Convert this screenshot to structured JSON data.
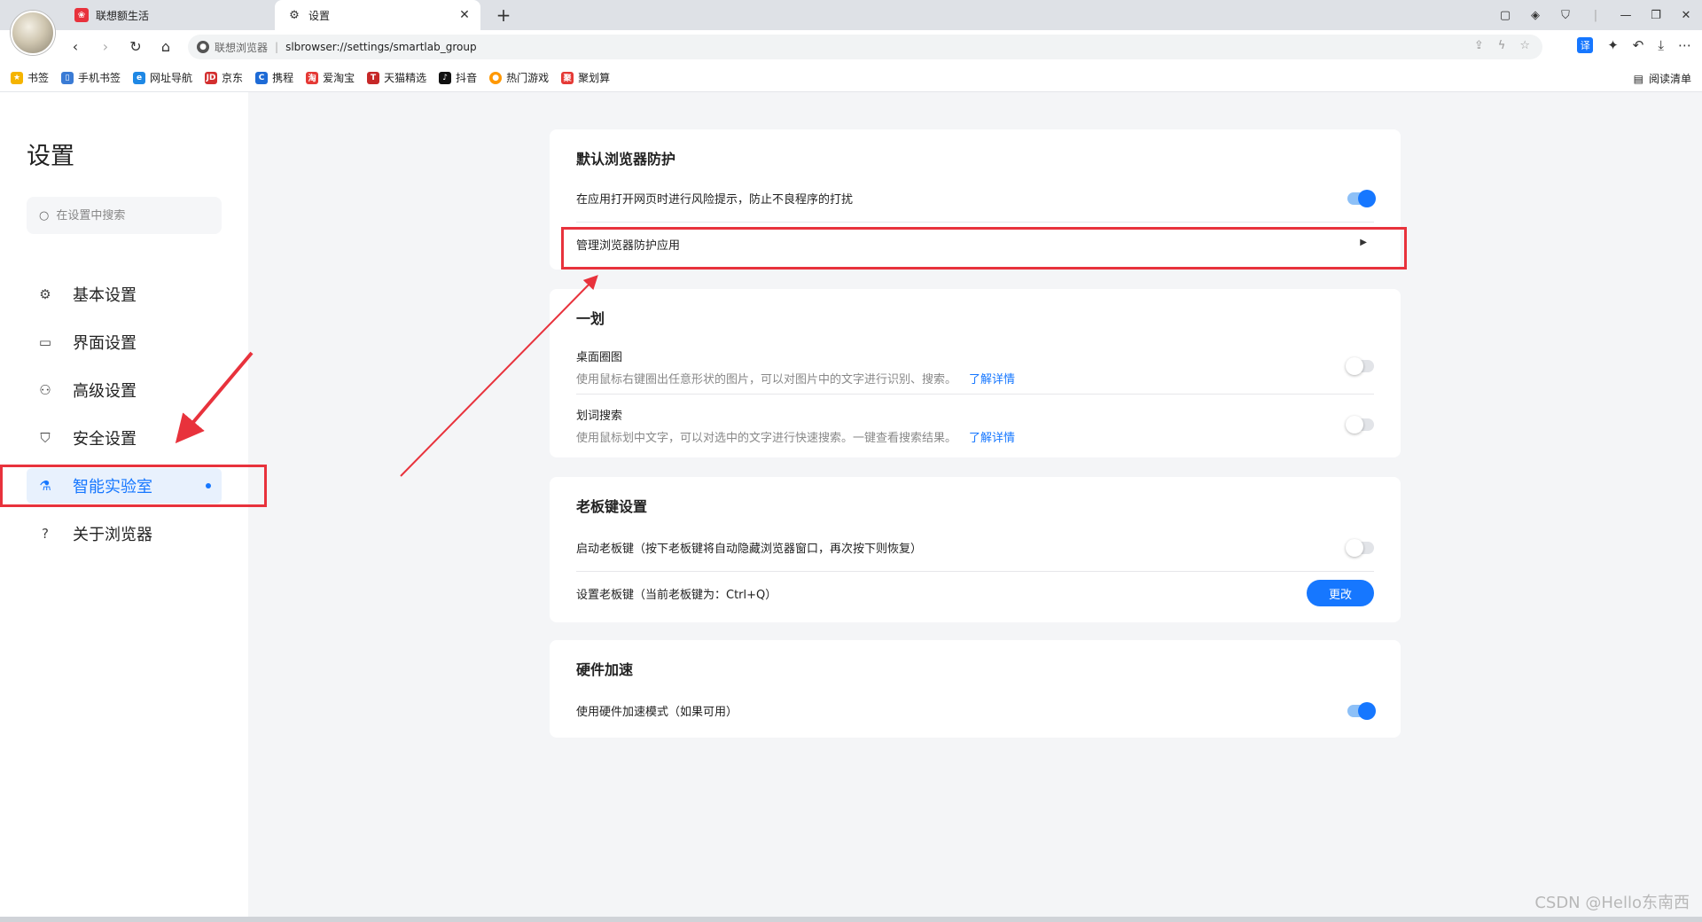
{
  "tabs": [
    {
      "title": "联想额生活",
      "favicon_color": "#e8323c",
      "active": false
    },
    {
      "title": "设置",
      "active": true
    }
  ],
  "address_bar": {
    "site_name": "联想浏览器",
    "url": "slbrowser://settings/smartlab_group"
  },
  "bookmarks": [
    {
      "label": "书签",
      "color": "#f5b400"
    },
    {
      "label": "手机书签",
      "color": "#3a7bd5"
    },
    {
      "label": "网址导航",
      "color": "#1e88e5"
    },
    {
      "label": "京东",
      "color": "#d32f2f"
    },
    {
      "label": "携程",
      "color": "#1e6bd6"
    },
    {
      "label": "爱淘宝",
      "color": "#e53935"
    },
    {
      "label": "天猫精选",
      "color": "#c62828"
    },
    {
      "label": "抖音",
      "color": "#111111"
    },
    {
      "label": "热门游戏",
      "color": "#ff9800"
    },
    {
      "label": "聚划算",
      "color": "#e53935"
    }
  ],
  "reading_list": "阅读清单",
  "sidebar": {
    "title": "设置",
    "search_placeholder": "在设置中搜索",
    "items": [
      {
        "label": "基本设置",
        "icon": "gear-icon"
      },
      {
        "label": "界面设置",
        "icon": "window-icon"
      },
      {
        "label": "高级设置",
        "icon": "people-icon"
      },
      {
        "label": "安全设置",
        "icon": "shield-icon"
      },
      {
        "label": "智能实验室",
        "icon": "flask-icon",
        "active": true
      },
      {
        "label": "关于浏览器",
        "icon": "help-icon"
      }
    ]
  },
  "sections": {
    "default_protect": {
      "title": "默认浏览器防护",
      "risk_prompt": {
        "label": "在应用打开网页时进行风险提示，防止不良程序的打扰",
        "enabled": true
      },
      "manage_apps": {
        "label": "管理浏览器防护应用"
      }
    },
    "yihua": {
      "title": "一划",
      "desktop_circle": {
        "label": "桌面圈图",
        "desc": "使用鼠标右键圈出任意形状的图片，可以对图片中的文字进行识别、搜索。",
        "link": "了解详情",
        "enabled": false
      },
      "word_search": {
        "label": "划词搜索",
        "desc": "使用鼠标划中文字，可以对选中的文字进行快速搜索。一键查看搜索结果。",
        "link": "了解详情",
        "enabled": false
      }
    },
    "boss_key": {
      "title": "老板键设置",
      "enable": {
        "label": "启动老板键（按下老板键将自动隐藏浏览器窗口，再次按下则恢复）",
        "enabled": false
      },
      "set_key": {
        "label": "设置老板键（当前老板键为：Ctrl+Q）",
        "button": "更改"
      }
    },
    "hardware": {
      "title": "硬件加速",
      "mode": {
        "label": "使用硬件加速模式（如果可用）",
        "enabled": true
      }
    }
  },
  "watermark": "CSDN @Hello东南西",
  "colors": {
    "accent": "#1677ff",
    "annotation": "#e8323c"
  }
}
